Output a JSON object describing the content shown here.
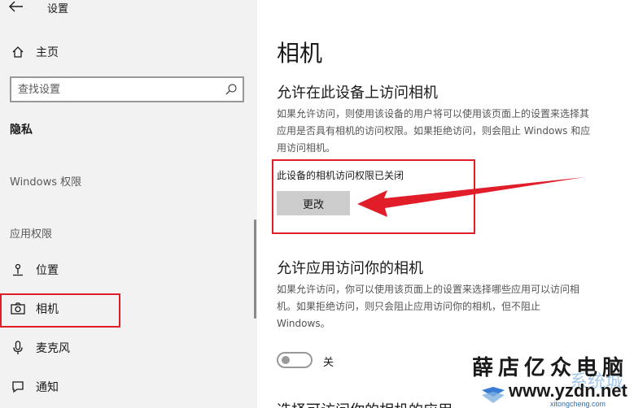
{
  "window": {
    "title": "设置"
  },
  "sidebar": {
    "home_label": "主页",
    "search": {
      "placeholder": "查找设置",
      "value": ""
    },
    "section_heading": "隐私",
    "group_windows": "Windows 权限",
    "group_apps": "应用权限",
    "items": [
      {
        "label": "位置",
        "icon": "location-icon"
      },
      {
        "label": "相机",
        "icon": "camera-icon"
      },
      {
        "label": "麦克风",
        "icon": "microphone-icon"
      },
      {
        "label": "通知",
        "icon": "notification-icon"
      }
    ]
  },
  "main": {
    "page_title": "相机",
    "section1": {
      "title": "允许在此设备上访问相机",
      "desc_lines": [
        "如果允许访问，则使用该设备的用户将可以使用该页面上的设置来选择其",
        "应用是否具有相机的访问权限。如果拒绝访问，则会阻止 Windows 和应",
        "用访问相机。"
      ],
      "status": "此设备的相机访问权限已关闭",
      "change_button": "更改"
    },
    "section2": {
      "title": "允许应用访问你的相机",
      "desc_lines": [
        "如果允许访问，你可以使用该页面上的设置来选择哪些应用可以访问相",
        "机。如果拒绝访问，则只会阻止应用访问你的相机，但不阻止",
        "Windows。"
      ],
      "toggle_label": "关",
      "toggle_on": false
    },
    "section3": {
      "title": "选择可访问你的相机的应用"
    }
  },
  "colors": {
    "highlight": "#e11d2a",
    "accent_watermark": "#2d6fb0"
  },
  "watermark": {
    "line1": "薛店亿众电脑",
    "url": "www.yzdn.net",
    "small": "xitongcheng.com",
    "cn": "系统城"
  }
}
